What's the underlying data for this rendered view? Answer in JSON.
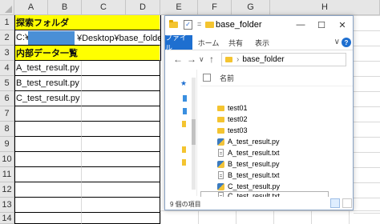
{
  "spreadsheet": {
    "columns": [
      "A",
      "B",
      "C",
      "D",
      "E",
      "F",
      "G",
      "H"
    ],
    "rows": [
      "1",
      "2",
      "3",
      "4",
      "5",
      "6",
      "7",
      "8",
      "9",
      "10",
      "11",
      "12",
      "13",
      "14"
    ],
    "a1": "探索フォルダ",
    "a2_prefix": "C:¥",
    "c2_suffix": "¥Desktop¥base_folder",
    "a3": "内部データ一覧",
    "a4": "A_test_result.py",
    "a5": "B_test_result.py",
    "a6": "C_test_result.py",
    "highlight_color": "#ffff00"
  },
  "explorer": {
    "title": "base_folder",
    "window_buttons": {
      "minimize": "—",
      "maximize": "☐",
      "close": "✕"
    },
    "qa_separator": "=",
    "qa_check": "✓",
    "ribbon_tabs": [
      "ファイル",
      "ホーム",
      "共有",
      "表示"
    ],
    "ribbon_collapse": "∨",
    "help": "?",
    "nav": {
      "back": "←",
      "forward": "→",
      "up": "↑",
      "dropdown": "∨"
    },
    "address": "base_folder",
    "header_name": "名前",
    "items": [
      {
        "name": "test01",
        "type": "folder"
      },
      {
        "name": "test02",
        "type": "folder"
      },
      {
        "name": "test03",
        "type": "folder"
      },
      {
        "name": "A_test_result.py",
        "type": "py"
      },
      {
        "name": "A_test_result.txt",
        "type": "txt"
      },
      {
        "name": "B_test_result.py",
        "type": "py"
      },
      {
        "name": "B_test_result.txt",
        "type": "txt"
      },
      {
        "name": "C_test_result.py",
        "type": "py"
      },
      {
        "name": "C_test_result.txt",
        "type": "txt"
      }
    ],
    "status": "9 個の項目"
  }
}
